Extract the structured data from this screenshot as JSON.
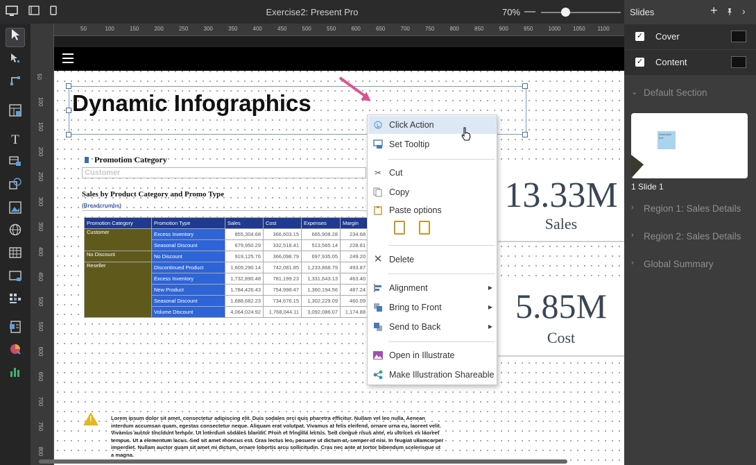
{
  "app": {
    "title": "Exercise2: Present Pro",
    "zoom": "70%",
    "zoom_level_fraction": 0.3
  },
  "ruler": {
    "top_ticks": [
      "50",
      "100",
      "150",
      "200",
      "250",
      "300",
      "350",
      "400",
      "450",
      "500",
      "550",
      "600",
      "650",
      "700",
      "750",
      "800",
      "850",
      "900",
      "950",
      "1000",
      "1050",
      "1100"
    ],
    "left_ticks": [
      "50",
      "100",
      "150",
      "200",
      "250",
      "300",
      "350",
      "400",
      "450",
      "500",
      "550",
      "600",
      "650",
      "700",
      "750",
      "800"
    ]
  },
  "toolbar": {
    "tools": [
      "pointer-icon",
      "subselect-icon",
      "connector-icon",
      "layout-icon",
      "text-icon",
      "text-table-icon",
      "shape-icon",
      "image-icon",
      "globe-icon",
      "table-icon",
      "container-icon",
      "grid-icon",
      "report-icon",
      "chart-icon",
      "bar-chart-icon"
    ]
  },
  "slide": {
    "title": "Dynamic Infographics",
    "promo_label": "Promotion Category",
    "customer_placeholder": "Customer",
    "subtitle": "Sales by Product Category and Promo Type",
    "breadcrumbs": "(Breadcrumbs)",
    "table": {
      "headers": [
        "Promotion Category",
        "Promotion Type",
        "Sales",
        "Cost",
        "Expenses",
        "Margin"
      ],
      "rows": [
        {
          "cat": "Customer",
          "type": "Excess Inventory",
          "vals": [
            "855,304.68",
            "366,603.15",
            "665,908.28",
            "234.68"
          ]
        },
        {
          "cat": "",
          "type": "Seasonal Discount",
          "vals": [
            "679,950.29",
            "332,518.41",
            "513,565.14",
            "228.81"
          ]
        },
        {
          "cat": "No Discount",
          "type": "No Discount",
          "vals": [
            "919,125.76",
            "366,098.79",
            "697,935.05",
            "249.20"
          ]
        },
        {
          "cat": "Reseller",
          "type": "Discontinued Product",
          "vals": [
            "1,609,290.14",
            "742,081.85",
            "1,233,868.79",
            "493.87"
          ]
        },
        {
          "cat": "",
          "type": "Excess Inventory",
          "vals": [
            "1,732,890.48",
            "781,199.23",
            "1,331,643.13",
            "463.40"
          ]
        },
        {
          "cat": "",
          "type": "New Product",
          "vals": [
            "1,784,426.43",
            "754,998.47",
            "1,360,194.56",
            "487.24"
          ]
        },
        {
          "cat": "",
          "type": "Seasonal Discount",
          "vals": [
            "1,688,682.23",
            "734,676.15",
            "1,302,229.09",
            "460.09"
          ]
        },
        {
          "cat": "",
          "type": "Volume Discount",
          "vals": [
            "4,064,024.92",
            "1,768,044.11",
            "3,092,086.07",
            "1,174.88"
          ]
        }
      ]
    },
    "kpi_sales": {
      "value": "13.33M",
      "label": "Sales"
    },
    "kpi_cost": {
      "value": "5.85M",
      "label": "Cost"
    },
    "lorem": "Lorem ipsum dolor sit amet, consectetur adipiscing elit. Duis sodales orci quis pharetra efficitur. Nullam vel leo nulla. Aenean interdum accumsan quam, egestas consectetur neque. Aliquam erat volutpat. Vivamus at felis eleifend, ornare urna eu, laoreet velit. Vivamus auctor tincidunt tempor. Ut interdum sodales blandit. Proin et fringilla lectus. Sed congue risus ante, eu ultrices ex laoreet tempus. Ut a elementum lacus. Sed sit amet rhoncus est. Cras lectus leo, posuere ut dictum at, semper id nisi. In feugiat ullamcorper imperdiet. Nullam auctor quam sit amet mi dictum, ornare lobortis arcu sollicitudin. Cras nec ante at tortor bibendum scelerisque ut a magna."
  },
  "context_menu": {
    "click_action": "Click Action",
    "set_tooltip": "Set Tooltip",
    "cut": "Cut",
    "copy": "Copy",
    "paste_options": "Paste options",
    "delete": "Delete",
    "alignment": "Alignment",
    "bring_to_front": "Bring to Front",
    "send_to_back": "Send to Back",
    "open_in_illustrate": "Open in Illustrate",
    "make_shareable": "Make Illustration Shareable"
  },
  "slides_panel": {
    "title": "Slides",
    "slides": [
      {
        "label": "Cover",
        "checked": true
      },
      {
        "label": "Content",
        "checked": true
      }
    ],
    "default_section": "Default Section",
    "thumb_label": "1 Slide 1",
    "thumb_note": "Illustration text",
    "sections": [
      "Region 1: Sales Details",
      "Region 2: Sales Details",
      "Global Summary"
    ]
  }
}
